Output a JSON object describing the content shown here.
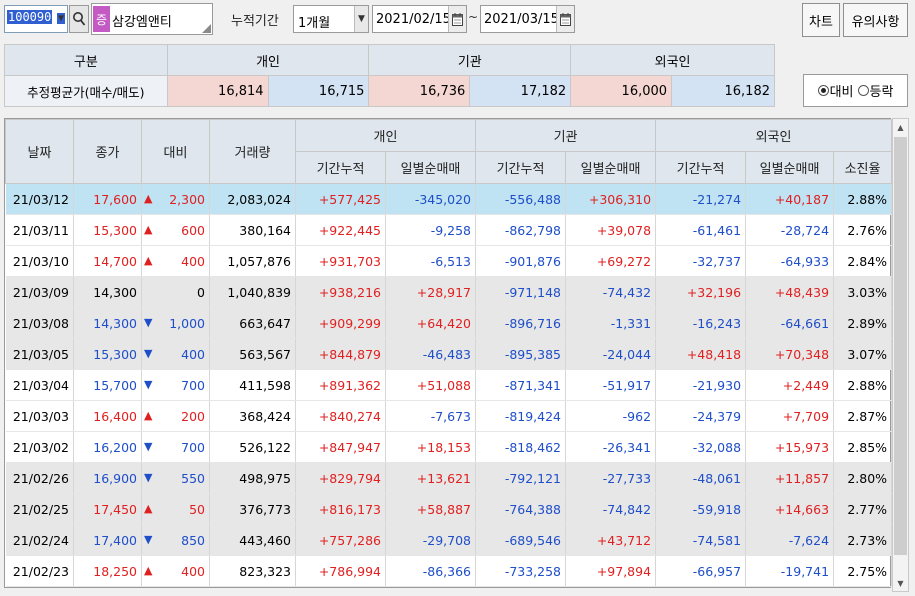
{
  "toolbar": {
    "code": "100090",
    "market_tag": "증",
    "stock_name": "삼강엠앤티",
    "period_label": "누적기간",
    "period_value": "1개월",
    "start_date": "2021/02/15",
    "tilde": "~",
    "end_date": "2021/03/15",
    "chart_button": "차트",
    "notes_button": "유의사항"
  },
  "summary": {
    "col_gubun": "구분",
    "col_individual": "개인",
    "col_institution": "기관",
    "col_foreign": "외국인",
    "row_label": "추정평균가(매수/매도)",
    "individual_buy": "16,814",
    "individual_sell": "16,715",
    "institution_buy": "16,736",
    "institution_sell": "17,182",
    "foreign_buy": "16,000",
    "foreign_sell": "16,182"
  },
  "mode": {
    "option_1": "대비",
    "option_2": "등락",
    "selected": "대비"
  },
  "grid": {
    "headers": {
      "date": "날짜",
      "close": "종가",
      "change": "대비",
      "volume": "거래량",
      "individual": "개인",
      "institution": "기관",
      "foreign": "외국인",
      "period_cum": "기간누적",
      "daily_net": "일별순매매",
      "exhaustion": "소진율"
    },
    "rows": [
      {
        "date": "21/03/12",
        "close": "17,600",
        "dir": "up",
        "change": "2,300",
        "volume": "2,083,024",
        "ind_cum": "+577,425",
        "ind_day": "-345,020",
        "inst_cum": "-556,488",
        "inst_day": "+306,310",
        "for_cum": "-21,274",
        "for_day": "+40,187",
        "exh": "2.88%"
      },
      {
        "date": "21/03/11",
        "close": "15,300",
        "dir": "up",
        "change": "600",
        "volume": "380,164",
        "ind_cum": "+922,445",
        "ind_day": "-9,258",
        "inst_cum": "-862,798",
        "inst_day": "+39,078",
        "for_cum": "-61,461",
        "for_day": "-28,724",
        "exh": "2.76%"
      },
      {
        "date": "21/03/10",
        "close": "14,700",
        "dir": "up",
        "change": "400",
        "volume": "1,057,876",
        "ind_cum": "+931,703",
        "ind_day": "-6,513",
        "inst_cum": "-901,876",
        "inst_day": "+69,272",
        "for_cum": "-32,737",
        "for_day": "-64,933",
        "exh": "2.84%"
      },
      {
        "date": "21/03/09",
        "close": "14,300",
        "dir": "none",
        "change": "0",
        "volume": "1,040,839",
        "ind_cum": "+938,216",
        "ind_day": "+28,917",
        "inst_cum": "-971,148",
        "inst_day": "-74,432",
        "for_cum": "+32,196",
        "for_day": "+48,439",
        "exh": "3.03%"
      },
      {
        "date": "21/03/08",
        "close": "14,300",
        "dir": "down",
        "change": "1,000",
        "volume": "663,647",
        "ind_cum": "+909,299",
        "ind_day": "+64,420",
        "inst_cum": "-896,716",
        "inst_day": "-1,331",
        "for_cum": "-16,243",
        "for_day": "-64,661",
        "exh": "2.89%"
      },
      {
        "date": "21/03/05",
        "close": "15,300",
        "dir": "down",
        "change": "400",
        "volume": "563,567",
        "ind_cum": "+844,879",
        "ind_day": "-46,483",
        "inst_cum": "-895,385",
        "inst_day": "-24,044",
        "for_cum": "+48,418",
        "for_day": "+70,348",
        "exh": "3.07%"
      },
      {
        "date": "21/03/04",
        "close": "15,700",
        "dir": "down",
        "change": "700",
        "volume": "411,598",
        "ind_cum": "+891,362",
        "ind_day": "+51,088",
        "inst_cum": "-871,341",
        "inst_day": "-51,917",
        "for_cum": "-21,930",
        "for_day": "+2,449",
        "exh": "2.88%"
      },
      {
        "date": "21/03/03",
        "close": "16,400",
        "dir": "up",
        "change": "200",
        "volume": "368,424",
        "ind_cum": "+840,274",
        "ind_day": "-7,673",
        "inst_cum": "-819,424",
        "inst_day": "-962",
        "for_cum": "-24,379",
        "for_day": "+7,709",
        "exh": "2.87%"
      },
      {
        "date": "21/03/02",
        "close": "16,200",
        "dir": "down",
        "change": "700",
        "volume": "526,122",
        "ind_cum": "+847,947",
        "ind_day": "+18,153",
        "inst_cum": "-818,462",
        "inst_day": "-26,341",
        "for_cum": "-32,088",
        "for_day": "+15,973",
        "exh": "2.85%"
      },
      {
        "date": "21/02/26",
        "close": "16,900",
        "dir": "down",
        "change": "550",
        "volume": "498,975",
        "ind_cum": "+829,794",
        "ind_day": "+13,621",
        "inst_cum": "-792,121",
        "inst_day": "-27,733",
        "for_cum": "-48,061",
        "for_day": "+11,857",
        "exh": "2.80%"
      },
      {
        "date": "21/02/25",
        "close": "17,450",
        "dir": "up",
        "change": "50",
        "volume": "376,773",
        "ind_cum": "+816,173",
        "ind_day": "+58,887",
        "inst_cum": "-764,388",
        "inst_day": "-74,842",
        "for_cum": "-59,918",
        "for_day": "+14,663",
        "exh": "2.77%"
      },
      {
        "date": "21/02/24",
        "close": "17,400",
        "dir": "down",
        "change": "850",
        "volume": "443,460",
        "ind_cum": "+757,286",
        "ind_day": "-29,708",
        "inst_cum": "-689,546",
        "inst_day": "+43,712",
        "for_cum": "-74,581",
        "for_day": "-7,624",
        "exh": "2.73%"
      },
      {
        "date": "21/02/23",
        "close": "18,250",
        "dir": "up",
        "change": "400",
        "volume": "823,323",
        "ind_cum": "+786,994",
        "ind_day": "-86,366",
        "inst_cum": "-733,258",
        "inst_day": "+97,894",
        "for_cum": "-66,957",
        "for_day": "-19,741",
        "exh": "2.75%"
      }
    ]
  },
  "colors": {
    "up": "#e02020",
    "down": "#1e4ec8",
    "selected_row": "#bfe3f2",
    "group_row": "#e7e7e7"
  }
}
